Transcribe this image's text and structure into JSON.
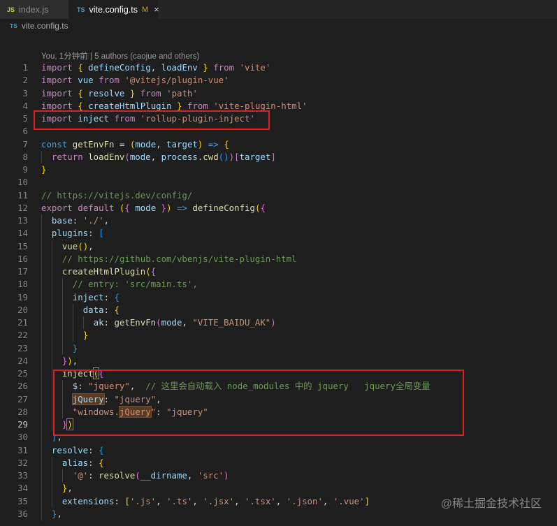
{
  "tabs": [
    {
      "icon": "JS",
      "label": "index.js",
      "active": false
    },
    {
      "icon": "TS",
      "label": "vite.config.ts",
      "modified": "M",
      "close": "×",
      "active": true
    }
  ],
  "breadcrumb": {
    "icon": "TS",
    "label": "vite.config.ts"
  },
  "codelens": "You, 1分钟前 | 5 authors (caojue and others)",
  "line_numbers": [
    "1",
    "2",
    "3",
    "4",
    "5",
    "6",
    "7",
    "8",
    "9",
    "10",
    "11",
    "12",
    "13",
    "14",
    "15",
    "16",
    "17",
    "18",
    "19",
    "20",
    "21",
    "22",
    "23",
    "24",
    "25",
    "26",
    "27",
    "28",
    "29",
    "30",
    "31",
    "32",
    "33",
    "34",
    "35",
    "36"
  ],
  "current_line": "29",
  "code": {
    "l1": [
      "import",
      "{",
      "defineConfig",
      "loadEnv",
      "}",
      "from",
      "'vite'"
    ],
    "l2": [
      "import",
      "vue",
      "from",
      "'@vitejs/plugin-vue'"
    ],
    "l3": [
      "import",
      "{",
      "resolve",
      "}",
      "from",
      "'path'"
    ],
    "l4": [
      "import",
      "{",
      "createHtmlPlugin",
      "}",
      "from",
      "'vite-plugin-html'"
    ],
    "l5": [
      "import",
      "inject",
      "from",
      "'rollup-plugin-inject'"
    ],
    "l7": [
      "const",
      "getEnvFn",
      "=",
      "(",
      "mode",
      "target",
      ")",
      "=>",
      "{"
    ],
    "l8": [
      "return",
      "loadEnv",
      "(",
      "mode",
      "process",
      "cwd",
      "()",
      ")",
      "[",
      "target",
      "]"
    ],
    "l9": [
      "}"
    ],
    "l11": [
      "// https://vitejs.dev/config/"
    ],
    "l12": [
      "export",
      "default",
      "(",
      "{",
      "mode",
      "}",
      ")",
      "=>",
      "defineConfig",
      "(",
      "{"
    ],
    "l13": [
      "base",
      "'./'"
    ],
    "l14": [
      "plugins",
      "["
    ],
    "l15": [
      "vue",
      "()"
    ],
    "l16": [
      "// https://github.com/vbenjs/vite-plugin-html"
    ],
    "l17": [
      "createHtmlPlugin",
      "(",
      "{"
    ],
    "l18": [
      "// entry: 'src/main.ts',"
    ],
    "l19": [
      "inject",
      "{"
    ],
    "l20": [
      "data",
      "{"
    ],
    "l21": [
      "ak",
      "getEnvFn",
      "(",
      "mode",
      "\"VITE_BAIDU_AK\"",
      ")"
    ],
    "l22": [
      "}"
    ],
    "l23": [
      "}"
    ],
    "l24": [
      "}",
      ")"
    ],
    "l25": [
      "inject",
      "(",
      "{"
    ],
    "l26": [
      "$",
      "\"jquery\"",
      "// 这里会自动载入 node_modules 中的 jquery   jquery全局变量"
    ],
    "l27": [
      "jQuery",
      "\"jquery\""
    ],
    "l28": [
      "\"windows.",
      "jQuery",
      "\"",
      "\"jquery\""
    ],
    "l29": [
      "}",
      ")"
    ],
    "l30": [
      "]"
    ],
    "l31": [
      "resolve",
      "{"
    ],
    "l32": [
      "alias",
      "{"
    ],
    "l33": [
      "'@'",
      "resolve",
      "(",
      "__dirname",
      "'src'",
      ")"
    ],
    "l34": [
      "}"
    ],
    "l35": [
      "extensions",
      "[",
      "'.js'",
      "'.ts'",
      "'.jsx'",
      "'.tsx'",
      "'.json'",
      "'.vue'",
      "]"
    ],
    "l36": [
      "}"
    ]
  },
  "watermark": "@稀土掘金技术社区",
  "colors": {
    "background": "#1e1e1e",
    "keyword": "#569cd6",
    "control_keyword": "#c586c0",
    "string": "#ce9178",
    "function": "#dcdcaa",
    "variable": "#9cdcfe",
    "comment": "#6a9955",
    "annotation_box": "#e02020"
  }
}
